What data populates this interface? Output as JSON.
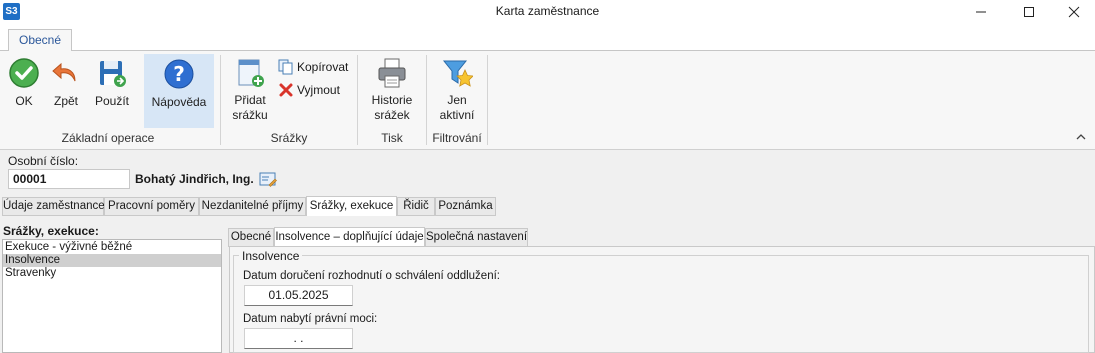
{
  "window": {
    "app_icon_text": "S3",
    "title": "Karta zaměstnance"
  },
  "ribbon": {
    "tab": "Obecné",
    "groups": {
      "basic": "Základní operace",
      "deductions": "Srážky",
      "print": "Tisk",
      "filter": "Filtrování"
    },
    "buttons": {
      "ok": "OK",
      "back": "Zpět",
      "apply": "Použít",
      "help": "Nápověda",
      "add_line1": "Přidat",
      "add_line2": "srážku",
      "copy": "Kopírovat",
      "cut": "Vyjmout",
      "history_line1": "Historie",
      "history_line2": "srážek",
      "only_line1": "Jen",
      "only_line2": "aktivní"
    }
  },
  "employee": {
    "label": "Osobní číslo:",
    "number": "00001",
    "name": "Bohatý Jindřich, Ing."
  },
  "tabs": [
    "Údaje zaměstnance",
    "Pracovní poměry",
    "Nezdanitelné příjmy",
    "Srážky, exekuce",
    "Řidič",
    "Poznámka"
  ],
  "deductions": {
    "label": "Srážky, exekuce:",
    "items": [
      "Exekuce - výživné běžné",
      "Insolvence",
      "Stravenky"
    ]
  },
  "subtabs": [
    "Obecné",
    "Insolvence – doplňující údaje",
    "Společná nastavení"
  ],
  "insolvence": {
    "group": "Insolvence",
    "field1_label": "Datum doručení rozhodnutí o schválení oddlužení:",
    "field1_value": "01.05.2025",
    "field2_label": "Datum nabytí právní moci:",
    "field2_value": ".   ."
  },
  "colors": {
    "accent": "#2b579a",
    "selected": "#d7e6f6"
  }
}
